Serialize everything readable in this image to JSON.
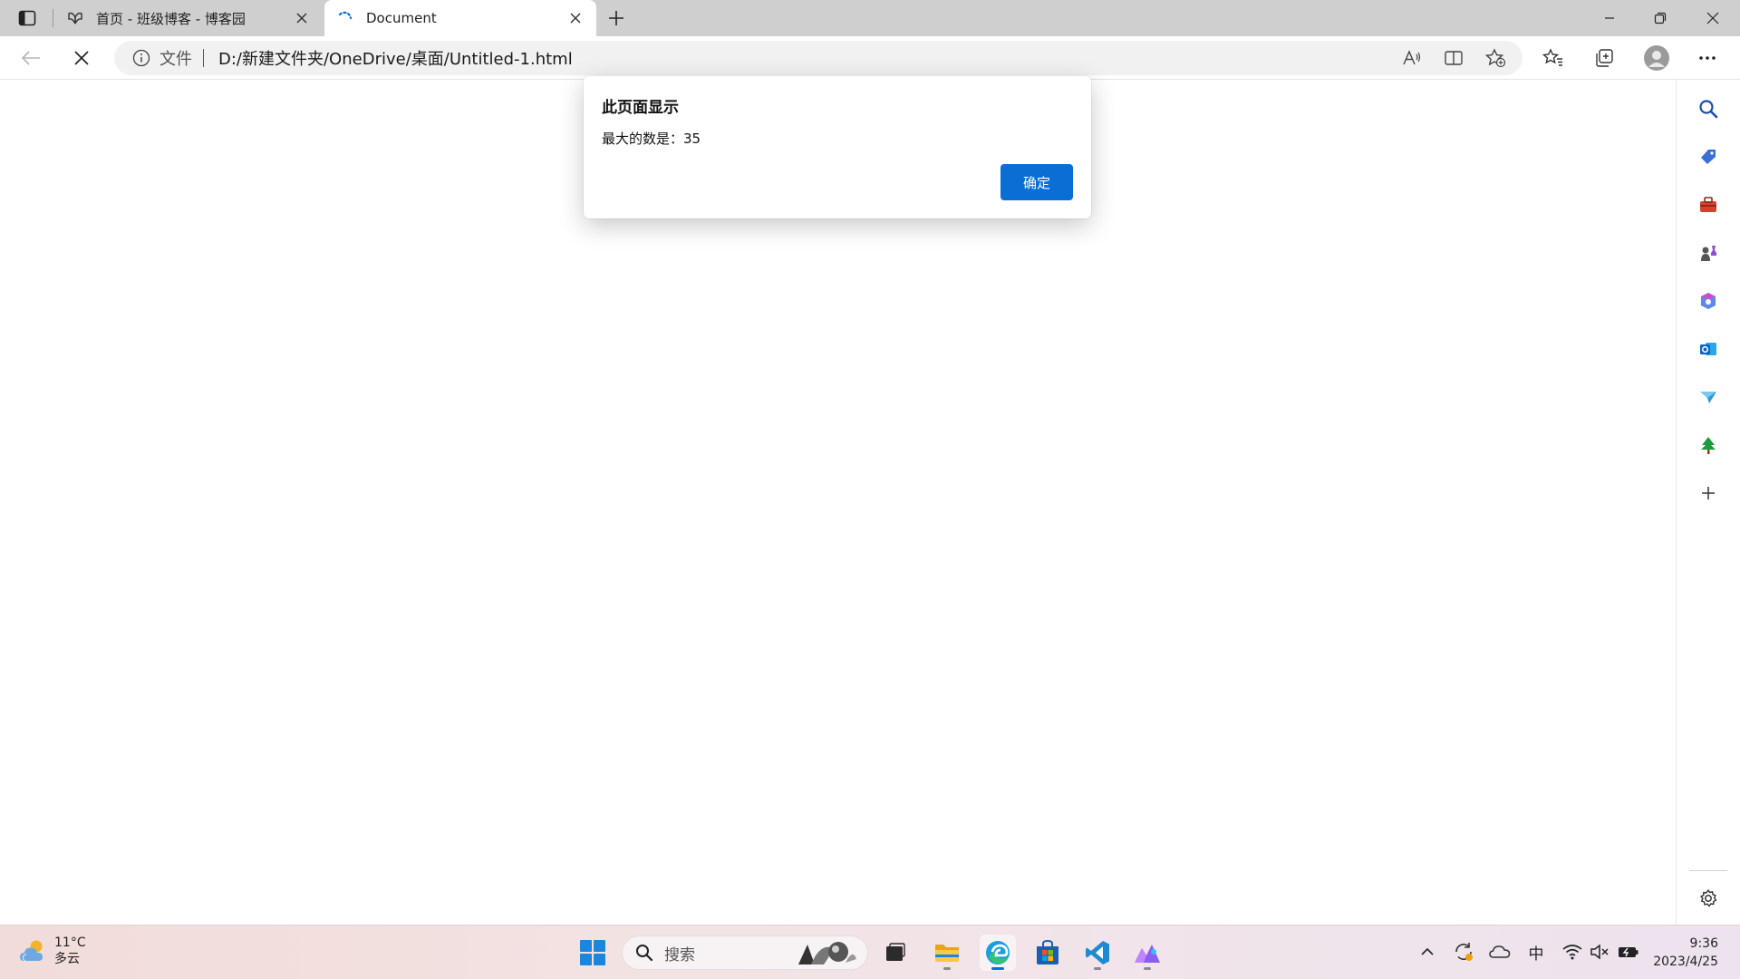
{
  "tabs": [
    {
      "title": "首页 - 班级博客 - 博客园",
      "active": false
    },
    {
      "title": "Document",
      "active": true
    }
  ],
  "address_bar": {
    "scheme_label": "文件",
    "url": "D:/新建文件夹/OneDrive/桌面/Untitled-1.html"
  },
  "dialog": {
    "title": "此页面显示",
    "message": "最大的数是：35",
    "ok_label": "确定"
  },
  "taskbar": {
    "weather_temp": "11°C",
    "weather_desc": "多云",
    "search_placeholder": "搜索",
    "ime_label": "中",
    "time": "9:36",
    "date": "2023/4/25"
  },
  "colors": {
    "accent": "#0a6fd4",
    "tabstrip": "#cfcfcf"
  }
}
